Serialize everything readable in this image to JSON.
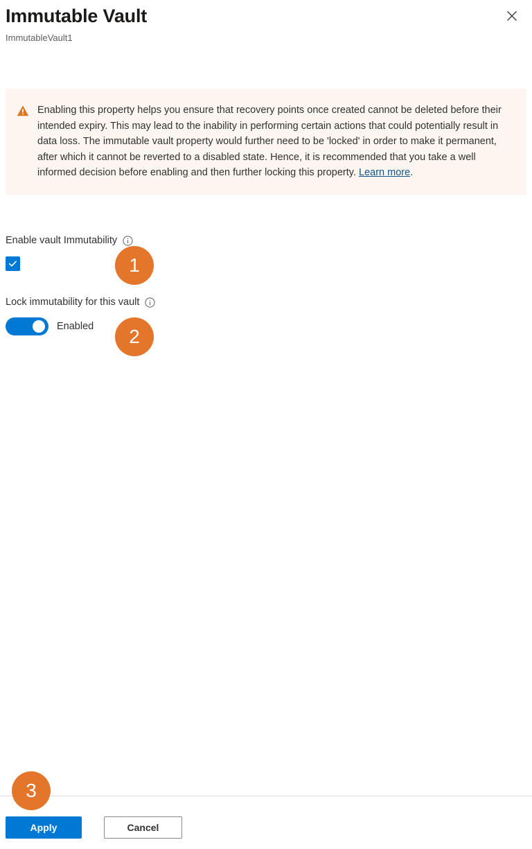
{
  "header": {
    "title": "Immutable Vault",
    "subtitle": "ImmutableVault1",
    "close_icon": "close-icon"
  },
  "banner": {
    "icon": "warning-triangle-icon",
    "text_before_link": "Enabling this property helps you ensure that recovery points once created cannot be deleted before their intended expiry. This may lead to the inability in performing certain actions that could potentially result in data loss. The immutable vault property would further need to be 'locked' in order to make it permanent, after which it cannot be reverted to a disabled state. Hence, it is recommended that you take a well informed decision before enabling and then further locking this property. ",
    "link_label": "Learn more",
    "text_after_link": ".",
    "background_color": "#fdf6f0",
    "icon_color": "#d97820"
  },
  "fields": {
    "enable_immutability": {
      "label": "Enable vault Immutability",
      "info_icon": "info-icon",
      "checkbox_checked": true,
      "accent_color": "#0078d4"
    },
    "lock_immutability": {
      "label": "Lock immutability for this vault",
      "info_icon": "info-icon",
      "toggle_on": true,
      "toggle_state_label": "Enabled",
      "accent_color": "#0078d4"
    }
  },
  "footer": {
    "apply_label": "Apply",
    "cancel_label": "Cancel",
    "primary_color": "#0078d4"
  },
  "annotations": {
    "badge_color": "#e3762a",
    "items": [
      {
        "number": "1"
      },
      {
        "number": "2"
      },
      {
        "number": "3"
      }
    ]
  }
}
